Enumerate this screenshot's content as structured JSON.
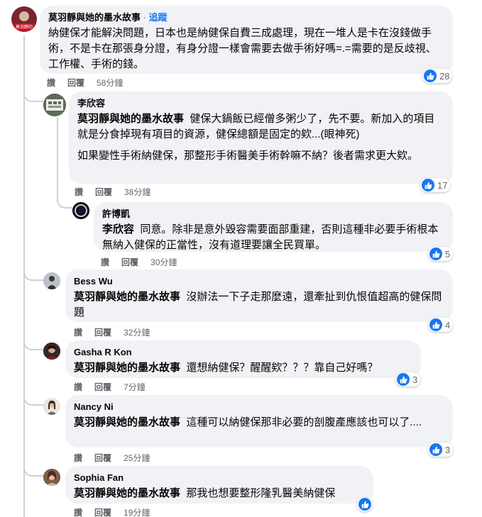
{
  "actions": {
    "like": "讚",
    "reply": "回覆"
  },
  "comments": [
    {
      "author": "莫羽靜與她的墨水故事",
      "separator": "·",
      "follow": "追蹤",
      "avatar_caption": "莫羽靜的",
      "text": "納健保才能解決問題，日本也是納健保自費三成處理，現在一堆人是卡在沒錢做手術，不是卡在那張身分證，有身分證一樣會需要去做手術好嗎=.=需要的是反歧視、工作權、手術的錢。",
      "time": "58分鐘",
      "reactions": "28"
    },
    {
      "author": "李欣容",
      "mention": "莫羽靜與她的墨水故事",
      "text": "健保大鍋飯已經僧多粥少了，先不要。新加入的項目就是分食掉現有項目的資源，健保總額是固定的欸...(眼神死)",
      "text2": "如果變性手術納健保，那整形手術醫美手術幹嘛不納？後者需求更大欸。",
      "time": "38分鐘",
      "reactions": "17"
    },
    {
      "author": "許博凱",
      "mention": "李欣容",
      "text": "同意。除非是意外毀容需要面部重建，否則這種非必要手術根本無納入健保的正當性，沒有道理要讓全民買單。",
      "time": "30分鐘",
      "reactions": "5"
    },
    {
      "author": "Bess Wu",
      "mention": "莫羽靜與她的墨水故事",
      "text": "沒辦法一下子走那麼遠，還牽扯到仇恨值超高的健保問題",
      "time": "32分鐘",
      "reactions": "4"
    },
    {
      "author": "Gasha R Kon",
      "mention": "莫羽靜與她的墨水故事",
      "text": "還想納健保？醒醒欸？？？靠自己好嗎？",
      "time": "7分鐘",
      "reactions": "3"
    },
    {
      "author": "Nancy Ni",
      "mention": "莫羽靜與她的墨水故事",
      "text": "這種可以納健保那非必要的剖腹產應該也可以了....",
      "time": "25分鐘",
      "reactions": "3"
    },
    {
      "author": "Sophia Fan",
      "mention": "莫羽靜與她的墨水故事",
      "text": "那我也想要整形隆乳醫美納健保",
      "time": "19分鐘",
      "reactions": ""
    }
  ],
  "colors": {
    "bubble": "#f0f2f5",
    "link": "#1877f2",
    "muted": "#65676b",
    "line": "#ced0d4"
  },
  "icons": {
    "reaction": "like-icon"
  }
}
